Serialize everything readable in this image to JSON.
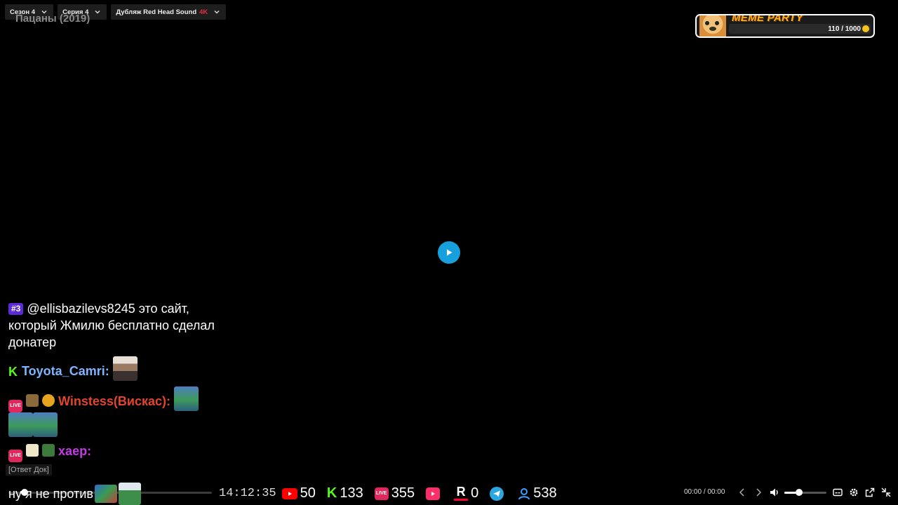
{
  "player": {
    "season": "Сезон 4",
    "episode": "Серия 4",
    "dub": "Дубляж Red Head Sound",
    "dub_quality": "4K",
    "title": "Пацаны (2019)",
    "current_time": "00:00",
    "separator": "/",
    "duration": "00:00",
    "volume_level": 0.35
  },
  "meme_party": {
    "title": "MEME PARTY",
    "progress_text": "110 / 1000",
    "progress_fraction": 0.11
  },
  "chat": {
    "rank": "#3",
    "message_1": "@ellisbazilevs8245 это сайт, который Жмилю бесплатно сделал донатер",
    "user_2": "Toyota_Camri:",
    "user_3": "Winstess(Вискас):",
    "user_4": "хаер:",
    "reply_tag": "[Ответ Док]",
    "last_message": "ну я не против"
  },
  "stream": {
    "clock": "14:12:35",
    "youtube": "50",
    "kick": "133",
    "vklive": "355",
    "vkvideo_icon": "play-icon",
    "rutube": "0",
    "telegram_icon": "paper-plane-icon",
    "viewers": "538"
  }
}
